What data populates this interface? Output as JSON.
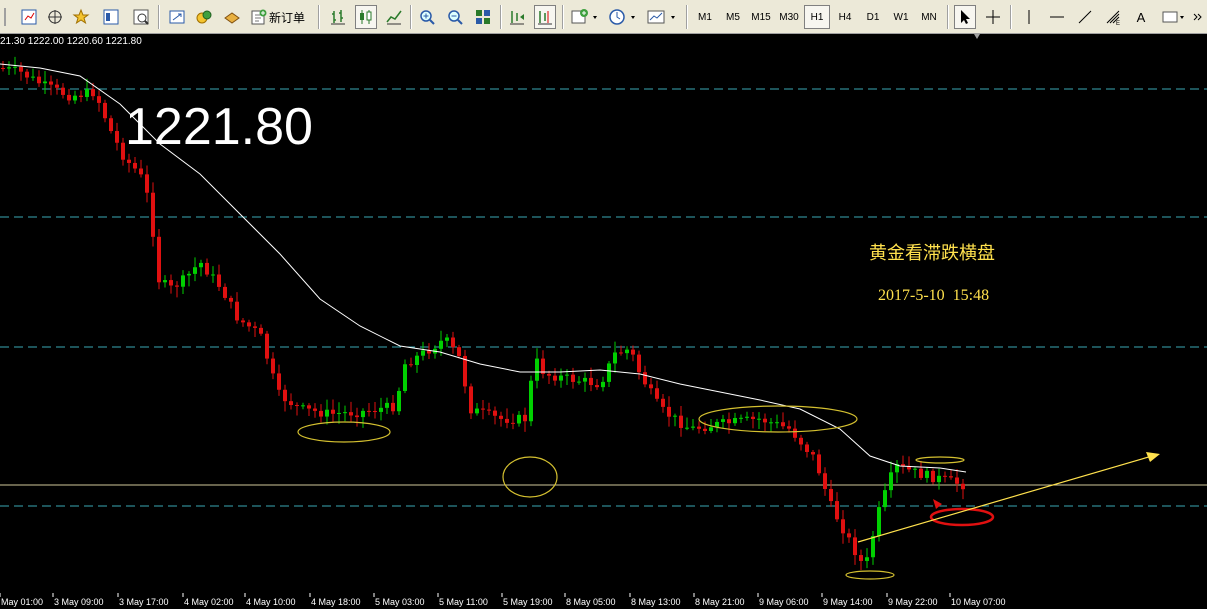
{
  "toolbar": {
    "items": [
      "new-chart",
      "profiles",
      "crosshair-move",
      "favorites",
      "navigator",
      "data-window",
      "fullscreen",
      "experts",
      "history",
      "new-order",
      "bar-chart",
      "candlestick-chart",
      "line-chart",
      "zoom-in",
      "zoom-out",
      "tile-windows",
      "autoscroll",
      "chart-shift",
      "indicators",
      "periods",
      "templates"
    ],
    "new_order_label": "新订单",
    "timeframes": [
      "M1",
      "M5",
      "M15",
      "M30",
      "H1",
      "H4",
      "D1",
      "W1",
      "MN"
    ],
    "active_timeframe": "H1",
    "drawing_tools": [
      "cursor",
      "crosshair",
      "vertical-line",
      "horizontal-line",
      "trendline",
      "fibonacci",
      "text",
      "arrow"
    ],
    "text_tool_label": "A"
  },
  "chart": {
    "ohlc_header": "21.30 1222.00 1220.60 1221.80",
    "price_big": "1221.80",
    "annotation_title": "黄金看滞跌横盘",
    "annotation_time": "2017-5-10  15:48",
    "time_labels": [
      "May 01:00",
      "3 May 09:00",
      "3 May 17:00",
      "4 May 02:00",
      "4 May 10:00",
      "4 May 18:00",
      "5 May 03:00",
      "5 May 11:00",
      "5 May 19:00",
      "8 May 05:00",
      "8 May 13:00",
      "8 May 21:00",
      "9 May 06:00",
      "9 May 14:00",
      "9 May 22:00",
      "10 May 07:00"
    ],
    "colors": {
      "background": "#000000",
      "bull": "#00d000",
      "bear": "#e01010",
      "grid": "#3aa9b4",
      "ma": "#ffffff",
      "annot": "#ffe14d",
      "ellipse": "#d4c030",
      "red_ellipse": "#e01010",
      "price_line": "#cfc79a"
    }
  }
}
